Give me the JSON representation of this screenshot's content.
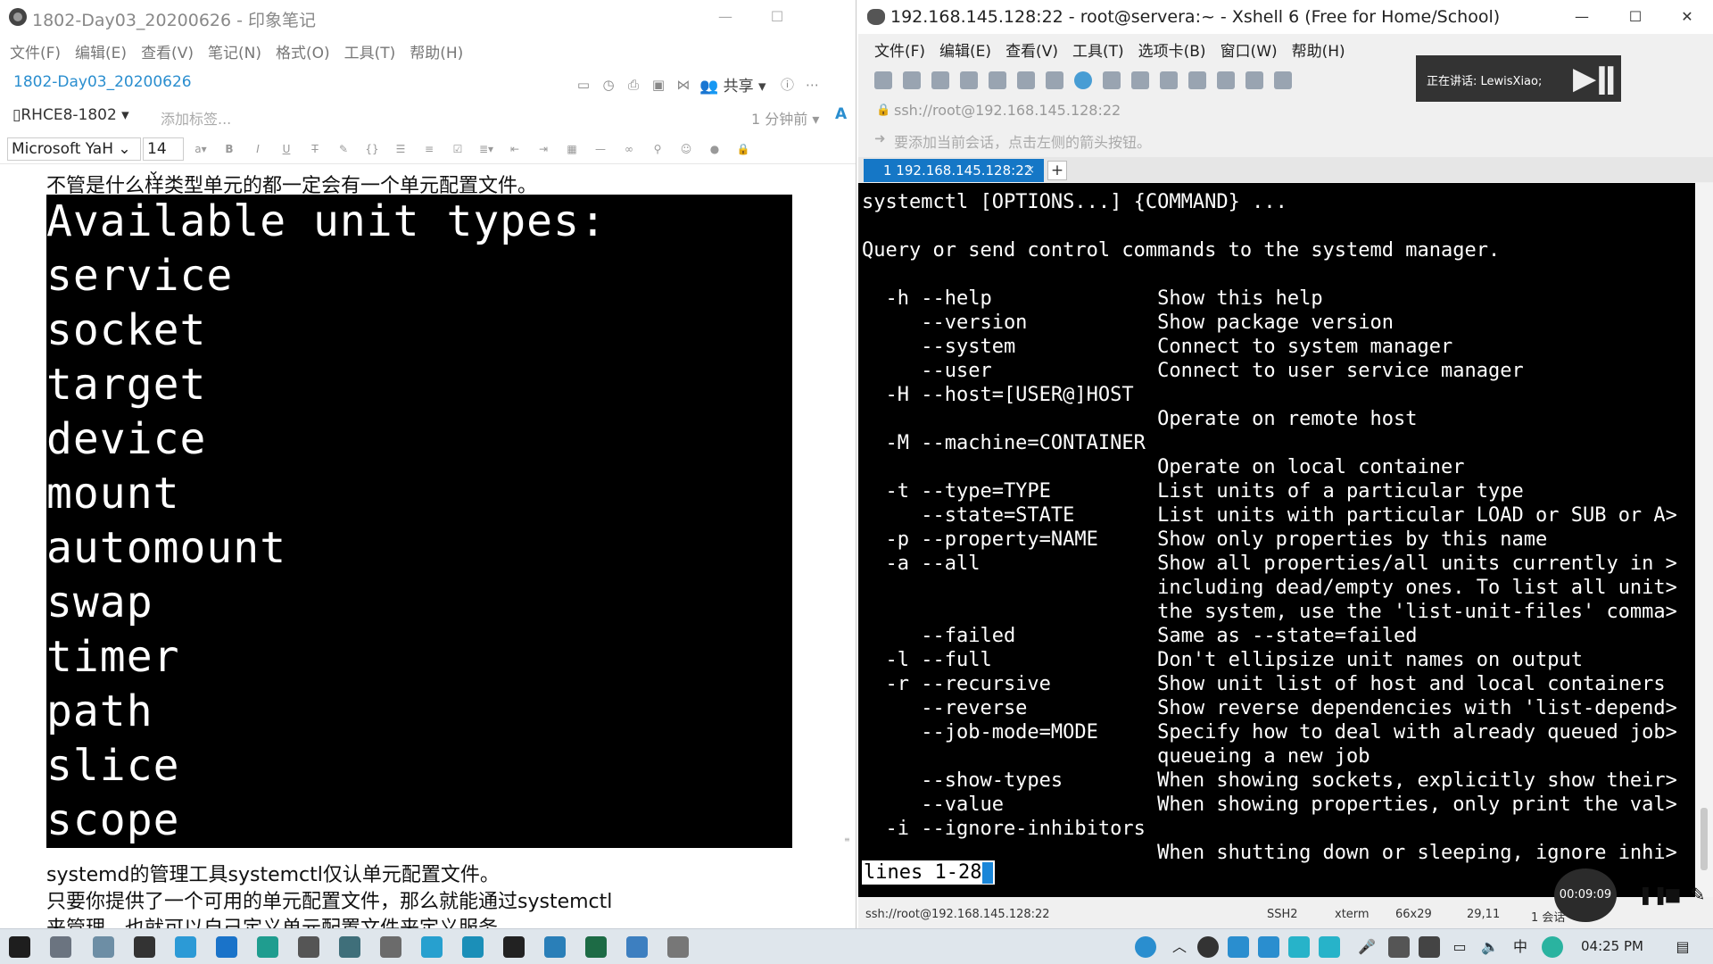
{
  "evernote": {
    "window_title": "1802-Day03_20200626 - 印象笔记",
    "menu": [
      "文件(F)",
      "编辑(E)",
      "查看(V)",
      "笔记(N)",
      "格式(O)",
      "工具(T)",
      "帮助(H)"
    ],
    "note_title": "1802-Day03_20200626",
    "share_label": "共享",
    "notebook": "RHCE8-1802",
    "add_tag_placeholder": "添加标签...",
    "edited_time": "1 分钟前",
    "font_family": "Microsoft YaH",
    "font_size": "14",
    "text_before": "不管是什么样类型单元的都一定会有一个单元配置文件。",
    "code_lines": [
      "Available unit types:",
      "service",
      "socket",
      "target",
      "device",
      "mount",
      "automount",
      "swap",
      "timer",
      "path",
      "slice",
      "scope"
    ],
    "text_after_1": "systemd的管理工具systemctl仅认单元配置文件。",
    "text_after_2": "只要你提供了一个可用的单元配置文件，那么就能通过systemctl",
    "text_after_3": "来管理，也就可以自己定义单元配置文件来定义服务。"
  },
  "xshell": {
    "window_title": "192.168.145.128:22 - root@servera:~ - Xshell 6 (Free for Home/School)",
    "menu": [
      "文件(F)",
      "编辑(E)",
      "查看(V)",
      "工具(T)",
      "选项卡(B)",
      "窗口(W)",
      "帮助(H)"
    ],
    "overlay_speaking": "正在讲话: LewisXiao;",
    "address": "ssh://root@192.168.145.128:22",
    "session_hint": "要添加当前会话，点击左侧的箭头按钮。",
    "tab_label": "1 192.168.145.128:22",
    "terminal_lines": [
      "systemctl [OPTIONS...] {COMMAND} ...",
      "",
      "Query or send control commands to the systemd manager.",
      "",
      "  -h --help              Show this help",
      "     --version           Show package version",
      "     --system            Connect to system manager",
      "     --user              Connect to user service manager",
      "  -H --host=[USER@]HOST",
      "                         Operate on remote host",
      "  -M --machine=CONTAINER",
      "                         Operate on local container",
      "  -t --type=TYPE         List units of a particular type",
      "     --state=STATE       List units with particular LOAD or SUB or A>",
      "  -p --property=NAME     Show only properties by this name",
      "  -a --all               Show all properties/all units currently in >",
      "                         including dead/empty ones. To list all unit>",
      "                         the system, use the 'list-unit-files' comma>",
      "     --failed            Same as --state=failed",
      "  -l --full              Don't ellipsize unit names on output",
      "  -r --recursive         Show unit list of host and local containers",
      "     --reverse           Show reverse dependencies with 'list-depend>",
      "     --job-mode=MODE     Specify how to deal with already queued job>",
      "                         queueing a new job",
      "     --show-types        When showing sockets, explicitly show their>",
      "     --value             When showing properties, only print the val>",
      "  -i --ignore-inhibitors",
      "                         When shutting down or sleeping, ignore inhi>"
    ],
    "pager_status": "lines 1-28",
    "status": {
      "connection": "ssh://root@192.168.145.128:22",
      "protocol": "SSH2",
      "term": "xterm",
      "size": "66x29",
      "cursor": "29,11",
      "sessions": "1 会话"
    },
    "recording_time": "00:09:09"
  },
  "taskbar": {
    "clock": "04:25 PM"
  }
}
